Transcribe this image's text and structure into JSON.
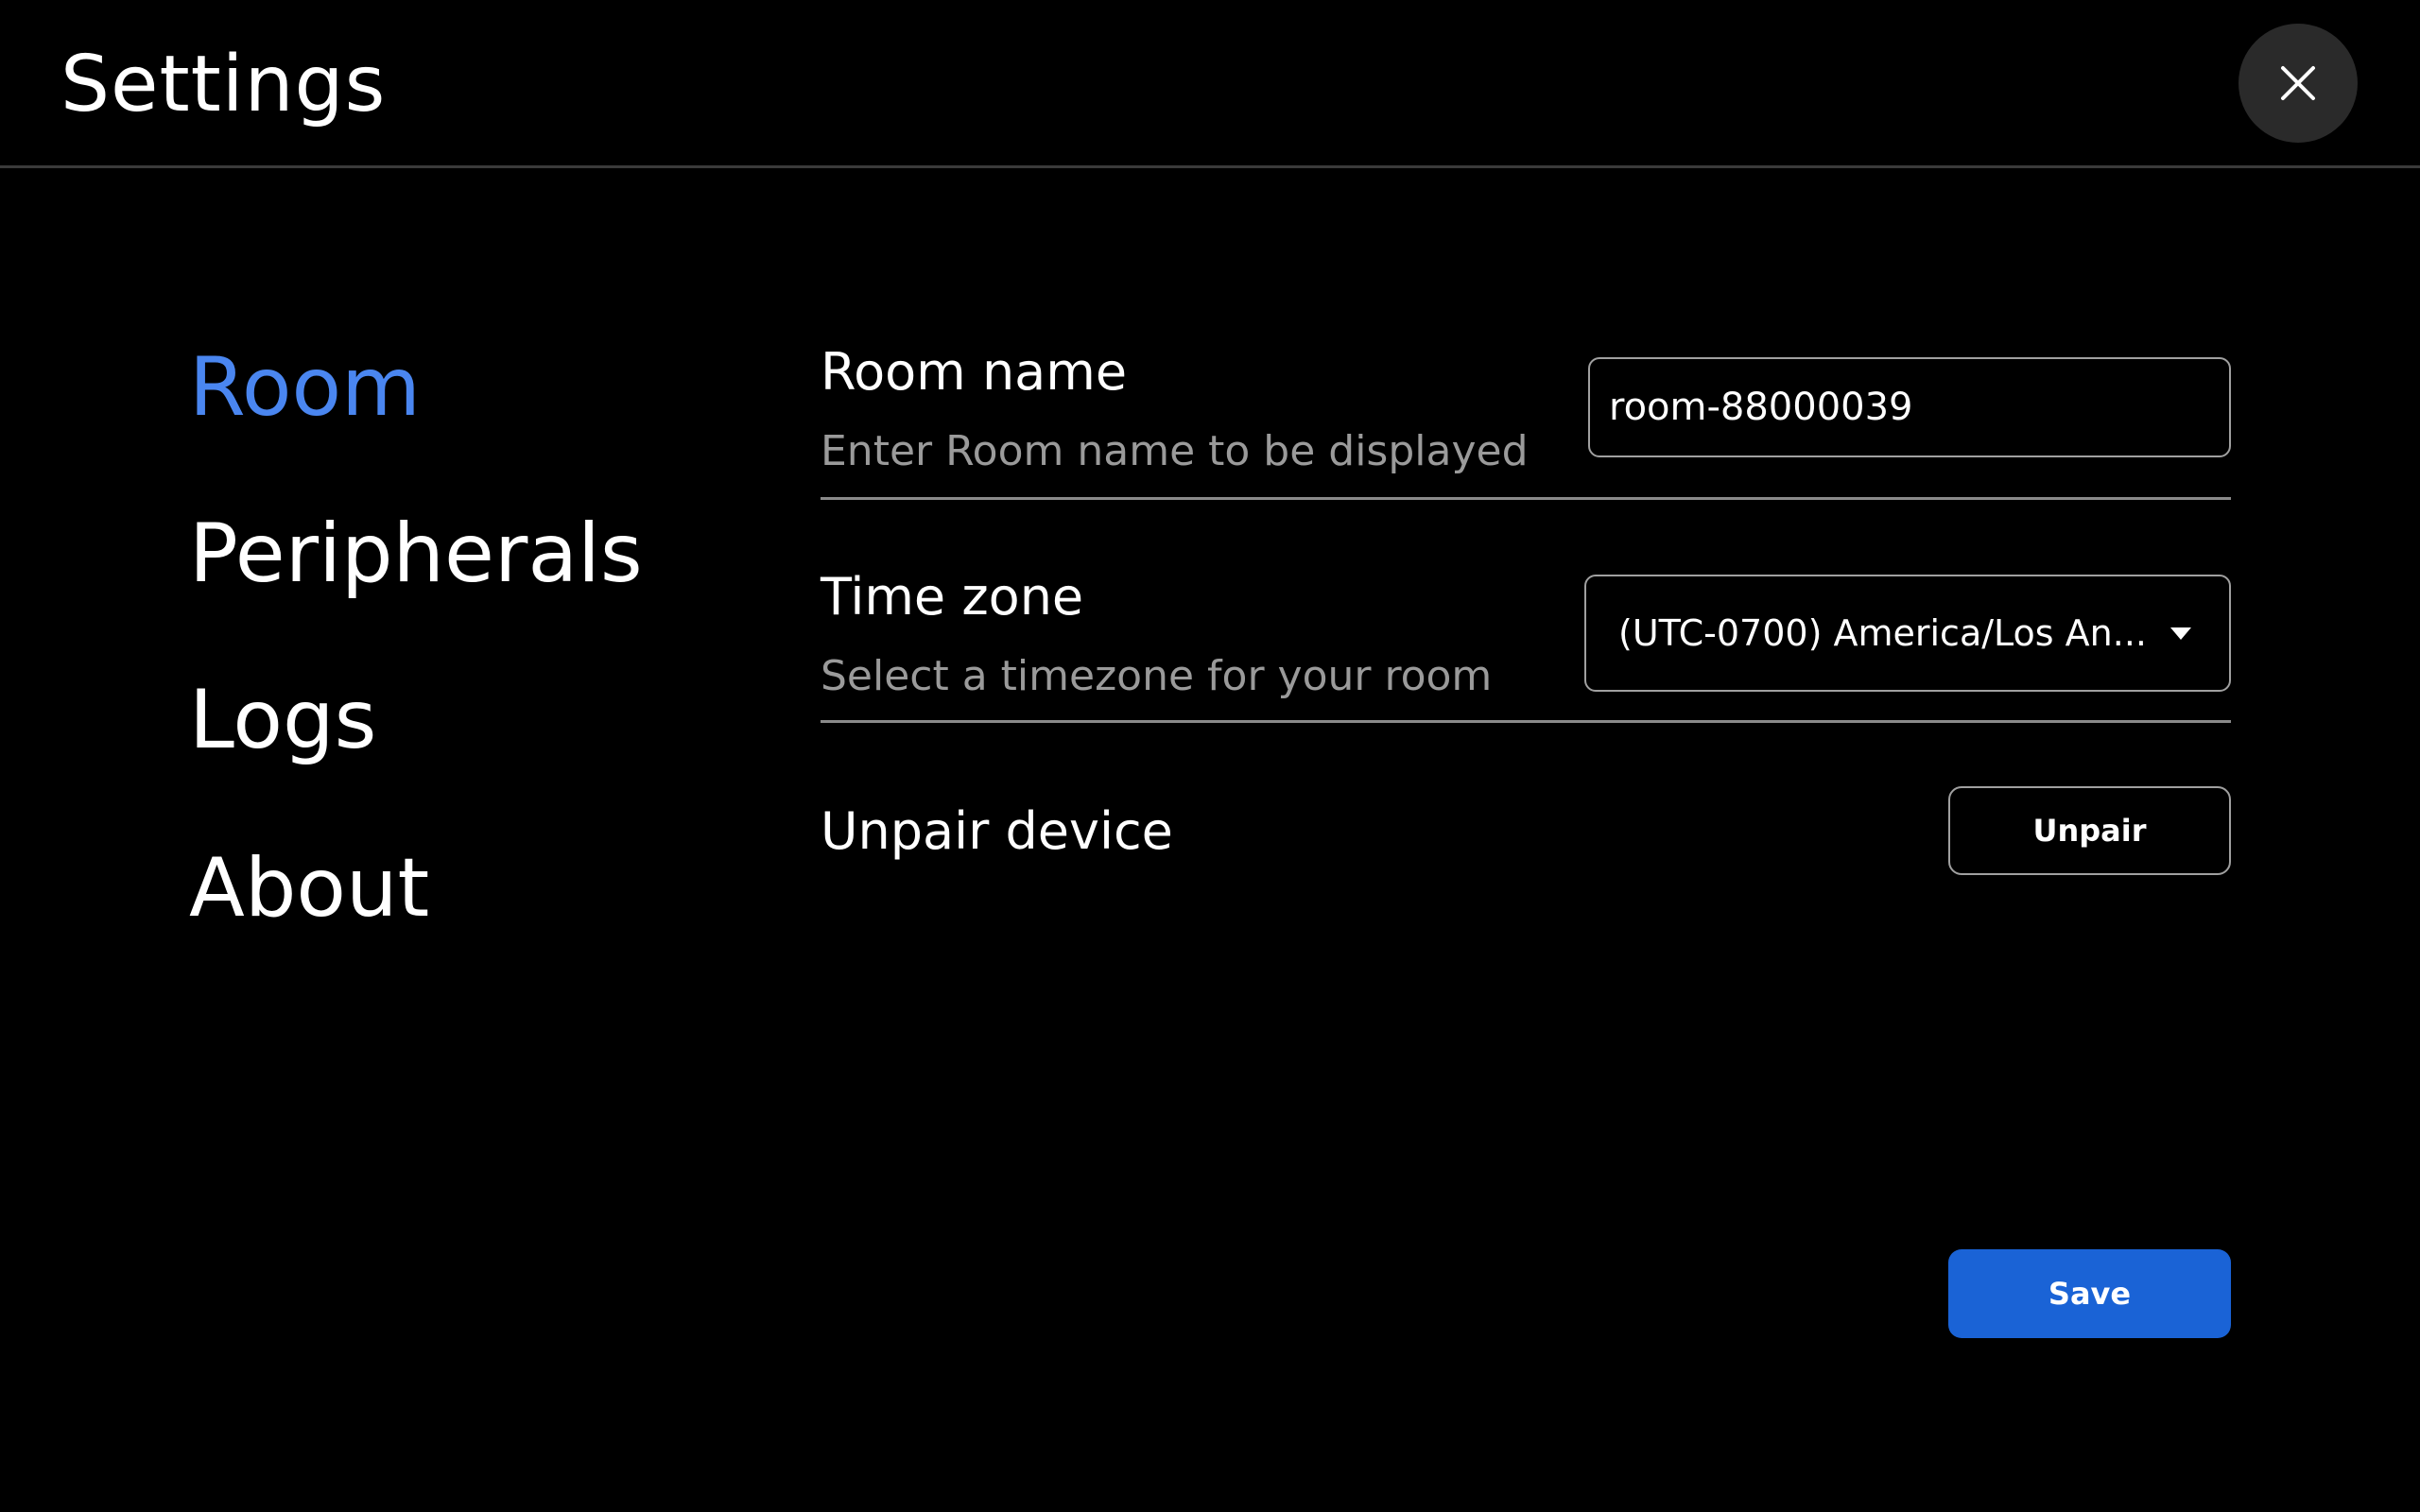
{
  "header": {
    "title": "Settings",
    "close_icon": "close-icon"
  },
  "nav": {
    "items": [
      {
        "label": "Room",
        "active": true
      },
      {
        "label": "Peripherals",
        "active": false
      },
      {
        "label": "Logs",
        "active": false
      },
      {
        "label": "About",
        "active": false
      }
    ]
  },
  "room": {
    "name": {
      "title": "Room name",
      "subtitle": "Enter Room name to be displayed",
      "value": "room-88000039"
    },
    "timezone": {
      "title": "Time zone",
      "subtitle": "Select a timezone for your room",
      "selected": "(UTC-0700) America/Los An..."
    },
    "unpair": {
      "title": "Unpair device",
      "button_label": "Unpair"
    }
  },
  "actions": {
    "save_label": "Save"
  },
  "colors": {
    "accent": "#4a86f0",
    "primary_button": "#1a63d6",
    "background": "#000000"
  }
}
